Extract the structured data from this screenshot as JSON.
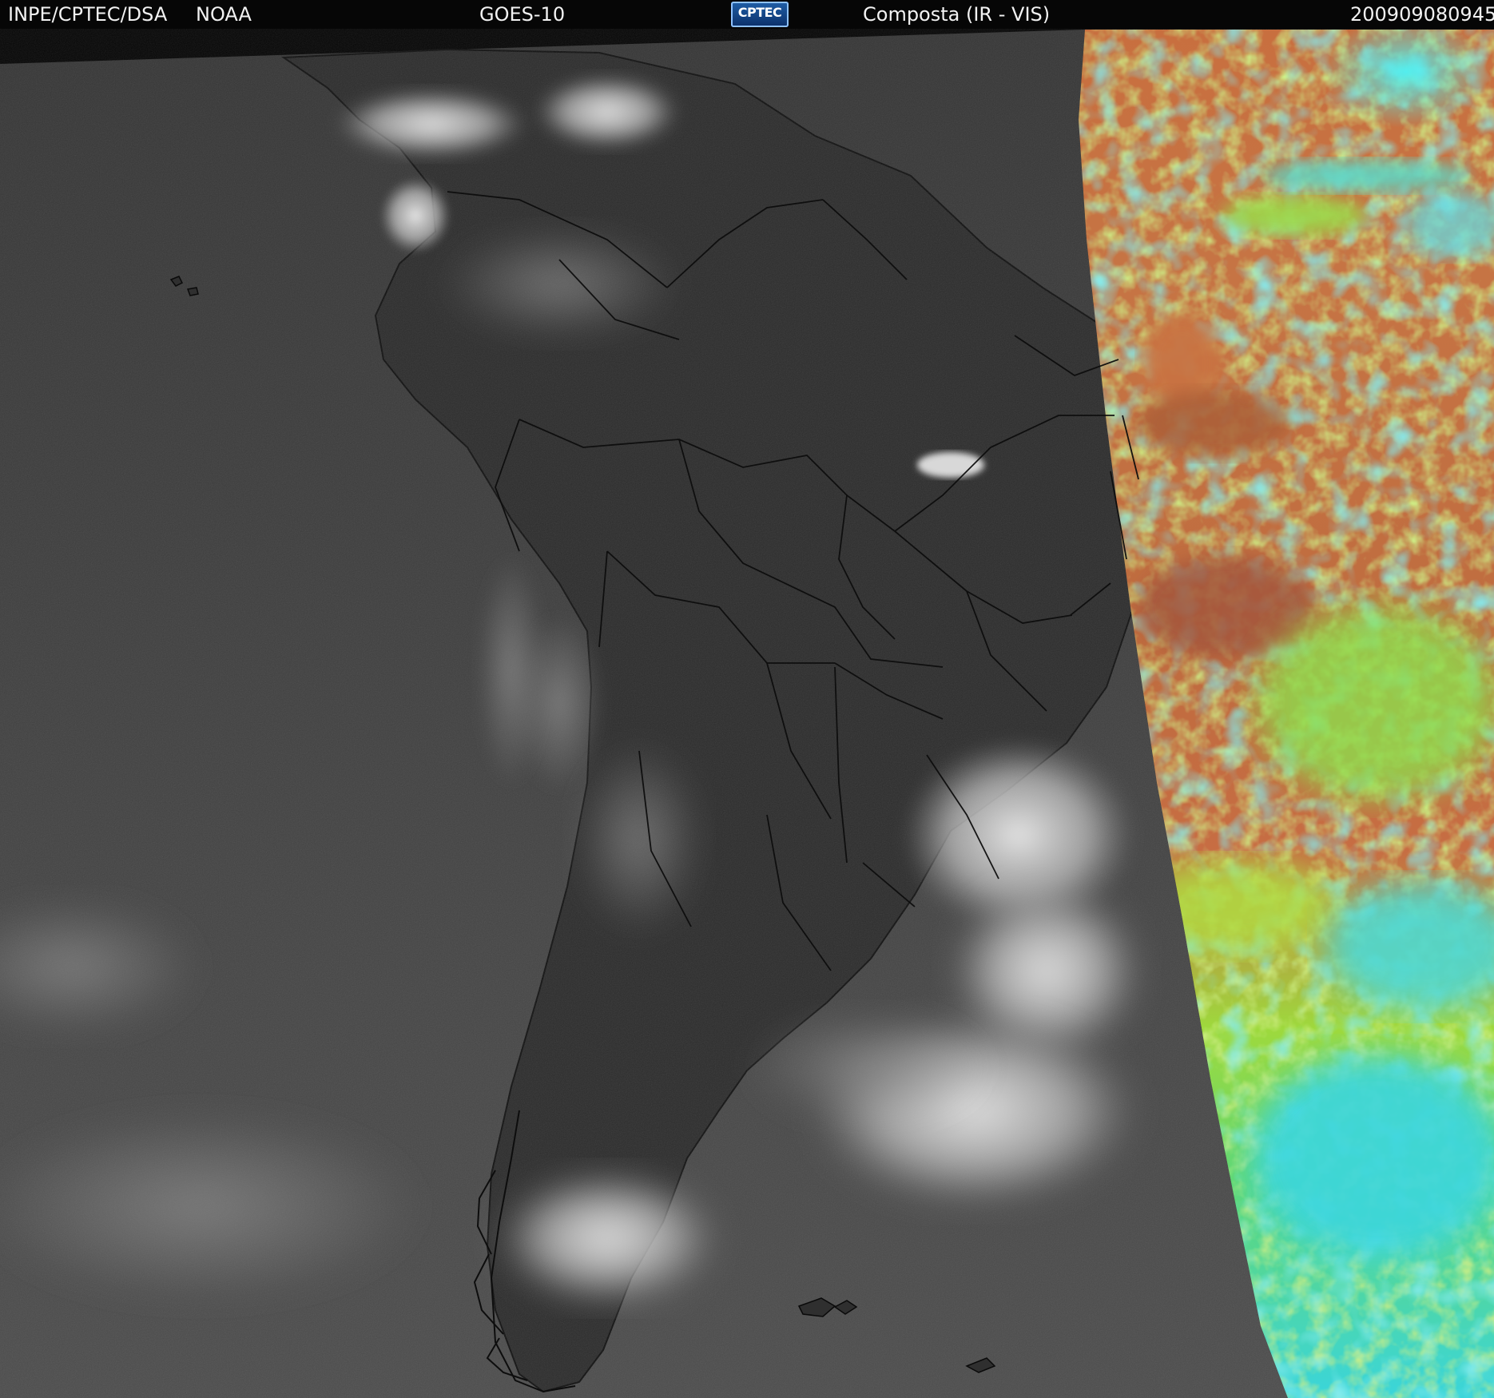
{
  "header": {
    "institution": "INPE/CPTEC/DSA",
    "agency": "NOAA",
    "satellite": "GOES-10",
    "logo_text": "CPTEC",
    "product": "Composta (IR - VIS)",
    "timestamp": "200909080945"
  },
  "colors": {
    "background": "#050505",
    "ocean_gray": "#4a4a4a",
    "land_dark": "#2f2f2f",
    "cloud_white": "#dcdcdc",
    "vis_orange": "#c96a3e",
    "vis_green": "#9edb3e",
    "vis_cyan": "#3fd4d8",
    "outline_black": "#111111"
  }
}
